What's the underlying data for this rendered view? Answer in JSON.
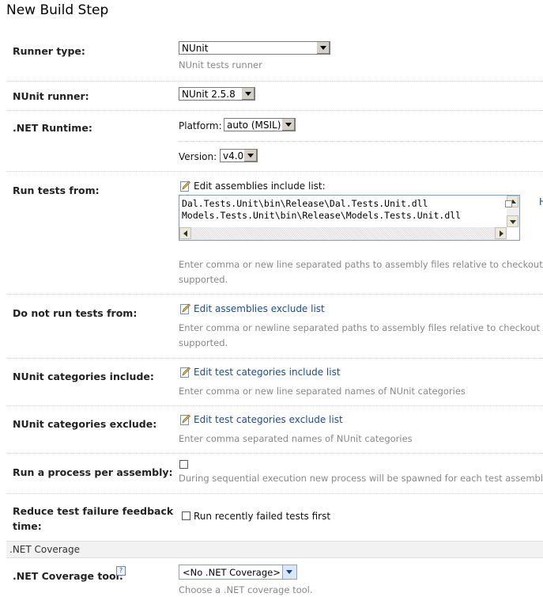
{
  "page": {
    "title": "New Build Step"
  },
  "runner_type": {
    "label": "Runner type:",
    "value": "NUnit",
    "desc": "NUnit tests runner"
  },
  "nunit_runner": {
    "label": "NUnit runner:",
    "value": "NUnit 2.5.8"
  },
  "net_runtime": {
    "label": ".NET Runtime:",
    "platform_label": "Platform:",
    "platform_value": "auto (MSIL)",
    "version_label": "Version:",
    "version_value": "v4.0"
  },
  "run_tests_from": {
    "label": "Run tests from:",
    "edit_label": "Edit assemblies include list:",
    "lines": [
      "Dal.Tests.Unit\\bin\\Release\\Dal.Tests.Unit.dll",
      "Models.Tests.Unit\\bin\\Release\\Models.Tests.Unit.dll"
    ],
    "desc_line1": "Enter comma or new line separated paths to assembly files relative to checkout dire",
    "desc_line2": "supported.",
    "side_link": "H"
  },
  "do_not_run": {
    "label": "Do not run tests from:",
    "link": "Edit assemblies exclude list",
    "desc_line1": "Enter comma or newline separated paths to assembly files relative to checkout direc",
    "desc_line2": "supported."
  },
  "categories_include": {
    "label": "NUnit categories include:",
    "link": "Edit test categories include list",
    "desc": "Enter comma or new line separated names of NUnit categories"
  },
  "categories_exclude": {
    "label": "NUnit categories exclude:",
    "link": "Edit test categories exclude list",
    "desc": "Enter comma separated names of NUnit categories"
  },
  "process_per_assembly": {
    "label": "Run a process per assembly:",
    "checked": false,
    "desc": "During sequential execution new process will be spawned for each test assembly."
  },
  "reduce_feedback": {
    "label_line1": "Reduce test failure feedback",
    "label_line2": "time:",
    "checkbox_label": "Run recently failed tests first",
    "checked": false
  },
  "coverage_section": {
    "title": ".NET Coverage"
  },
  "coverage_tool": {
    "label": ".NET Coverage tool:",
    "help": "?",
    "value": "<No .NET Coverage>",
    "desc": "Choose a .NET coverage tool."
  },
  "colors": {
    "link": "#1a4a9a",
    "muted": "#888888",
    "label": "#222222"
  }
}
